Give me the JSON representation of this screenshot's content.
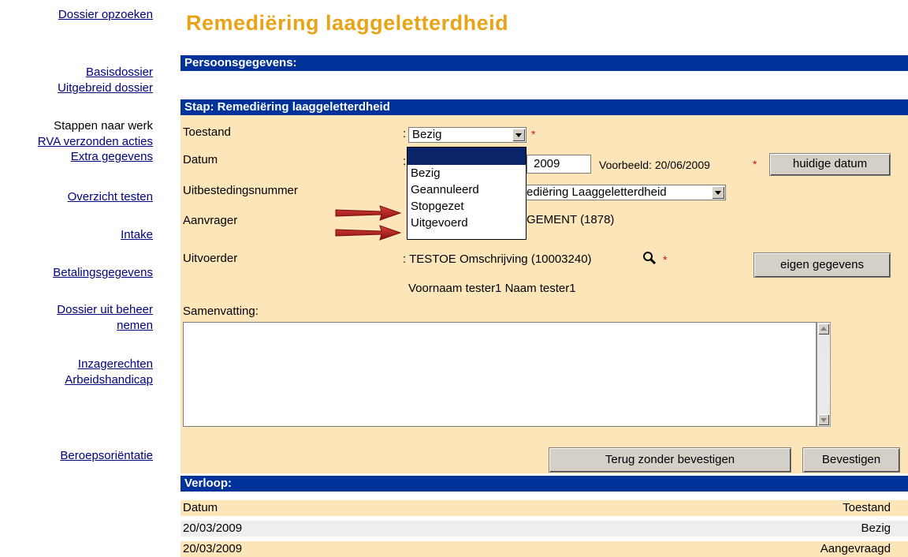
{
  "sidebar": {
    "dossier_opzoeken": "Dossier opzoeken",
    "basisdossier": "Basisdossier",
    "uitgebreid_dossier": "Uitgebreid dossier",
    "stappen_naar_werk": "Stappen naar werk",
    "rva_verzonden_acties": "RVA verzonden acties",
    "extra_gegevens": "Extra gegevens",
    "overzicht_testen": "Overzicht testen",
    "intake": "Intake",
    "betalingsgegevens": "Betalingsgegevens",
    "dossier_uit_beheer_1": "Dossier uit beheer",
    "dossier_uit_beheer_2": "nemen",
    "inzagerechten": "Inzagerechten",
    "arbeidshandicap": "Arbeidshandicap",
    "beroepsorientatie": "Beroepsoriëntatie"
  },
  "page_title": "Remediëring laaggeletterdheid",
  "persoonsgegevens_header": "Persoonsgegevens:",
  "stap": {
    "header": "Stap: Remediëring laaggeletterdheid",
    "toestand_label": "Toestand",
    "toestand_value": "Bezig",
    "datum_label": "Datum",
    "datum_value": "2009",
    "datum_example": "Voorbeeld: 20/06/2009",
    "huidige_datum_button": "huidige datum",
    "uitbesteding_label": "Uitbestedingsnummer",
    "uitbesteding_value": "ediëring Laaggeletterdheid",
    "aanvrager_label": "Aanvrager",
    "aanvrager_value": "GEMENT (1878)",
    "uitvoerder_label": "Uitvoerder",
    "uitvoerder_value": ": TESTOE Omschrijving (10003240)",
    "eigen_gegevens_button": "eigen gegevens",
    "uitvoerder_name": "Voornaam tester1 Naam tester1",
    "samenvatting_label": "Samenvatting:",
    "colon": ":",
    "required_mark": "*",
    "terug_button": "Terug zonder bevestigen",
    "bevestigen_button": "Bevestigen"
  },
  "dropdown_options": [
    "",
    "Bezig",
    "Geannuleerd",
    "Stopgezet",
    "Uitgevoerd"
  ],
  "verloop": {
    "header": "Verloop:",
    "col_datum": "Datum",
    "col_toestand": "Toestand",
    "rows": [
      {
        "datum": "20/03/2009",
        "toestand": "Bezig"
      },
      {
        "datum": "20/03/2009",
        "toestand": "Aangevraagd"
      }
    ]
  },
  "colors": {
    "header_bar": "#003399",
    "form_background": "#FCE6B9",
    "title": "#E8A317",
    "link": "#000080",
    "arrow": "#B22222",
    "highlight": "#0a246a"
  },
  "icons": [
    "magnifier-icon",
    "arrow-pointer-icon",
    "chevron-down-icon",
    "scroll-up-icon",
    "scroll-down-icon"
  ]
}
